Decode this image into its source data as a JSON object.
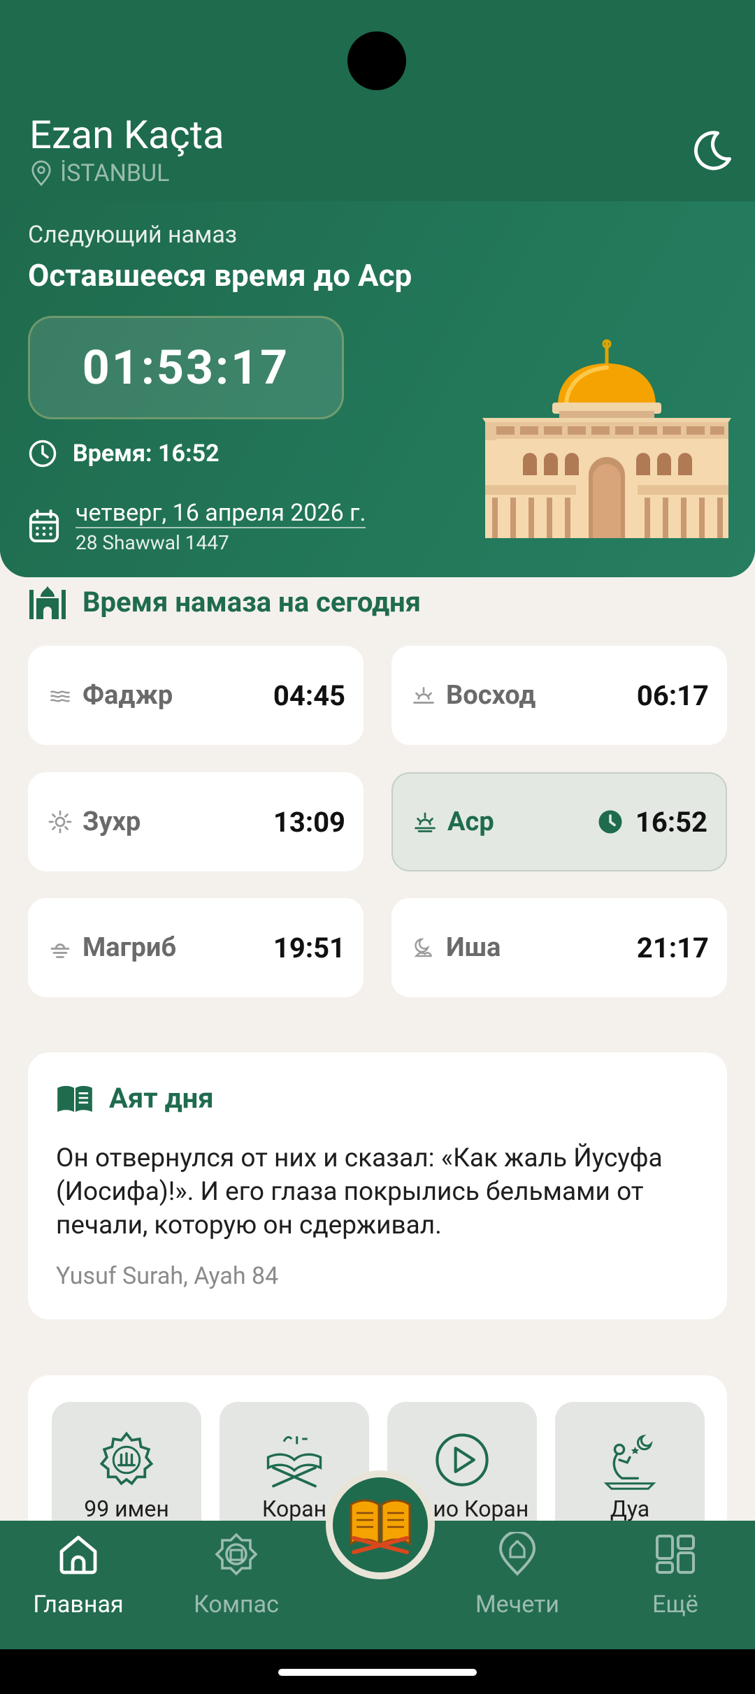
{
  "app": {
    "title": "Ezan Kaçta",
    "location": "İSTANBUL"
  },
  "next_prayer": {
    "label": "Следующий намаз",
    "title": "Оставшееся время до Аср",
    "countdown": "01:53:17",
    "time_text": "Время: 16:52",
    "gregorian_date": "четверг, 16 апреля 2026 г.",
    "hijri_date": "28 Shawwal 1447"
  },
  "today": {
    "heading": "Время намаза на сегодня",
    "prayers": [
      {
        "name": "Фаджр",
        "time": "04:45",
        "icon": "fajr-icon"
      },
      {
        "name": "Восход",
        "time": "06:17",
        "icon": "sunrise-icon"
      },
      {
        "name": "Зухр",
        "time": "13:09",
        "icon": "sun-icon"
      },
      {
        "name": "Аср",
        "time": "16:52",
        "icon": "asr-icon",
        "active": true
      },
      {
        "name": "Магриб",
        "time": "19:51",
        "icon": "sunset-icon"
      },
      {
        "name": "Иша",
        "time": "21:17",
        "icon": "night-icon"
      }
    ]
  },
  "ayah": {
    "heading": "Аят дня",
    "text": "Он отвернулся от них и сказал: «Как жаль Йусуфа (Иосифа)!». И его глаза покрылись бельмами от печали, которую он сдерживал.",
    "reference": "Yusuf Surah, Ayah 84"
  },
  "features": [
    {
      "label": "99 имен",
      "icon": "allah-name-icon"
    },
    {
      "label": "Коран",
      "icon": "quran-stand-icon"
    },
    {
      "label": "Аудио Коран",
      "icon": "play-icon"
    },
    {
      "label": "Дуа",
      "icon": "dua-icon"
    }
  ],
  "nav": {
    "home": "Главная",
    "compass": "Компас",
    "mosques": "Мечети",
    "more": "Ещё"
  },
  "colors": {
    "primary": "#1f6b4e",
    "background": "#f4f1ec",
    "dome": "#f5a300"
  }
}
